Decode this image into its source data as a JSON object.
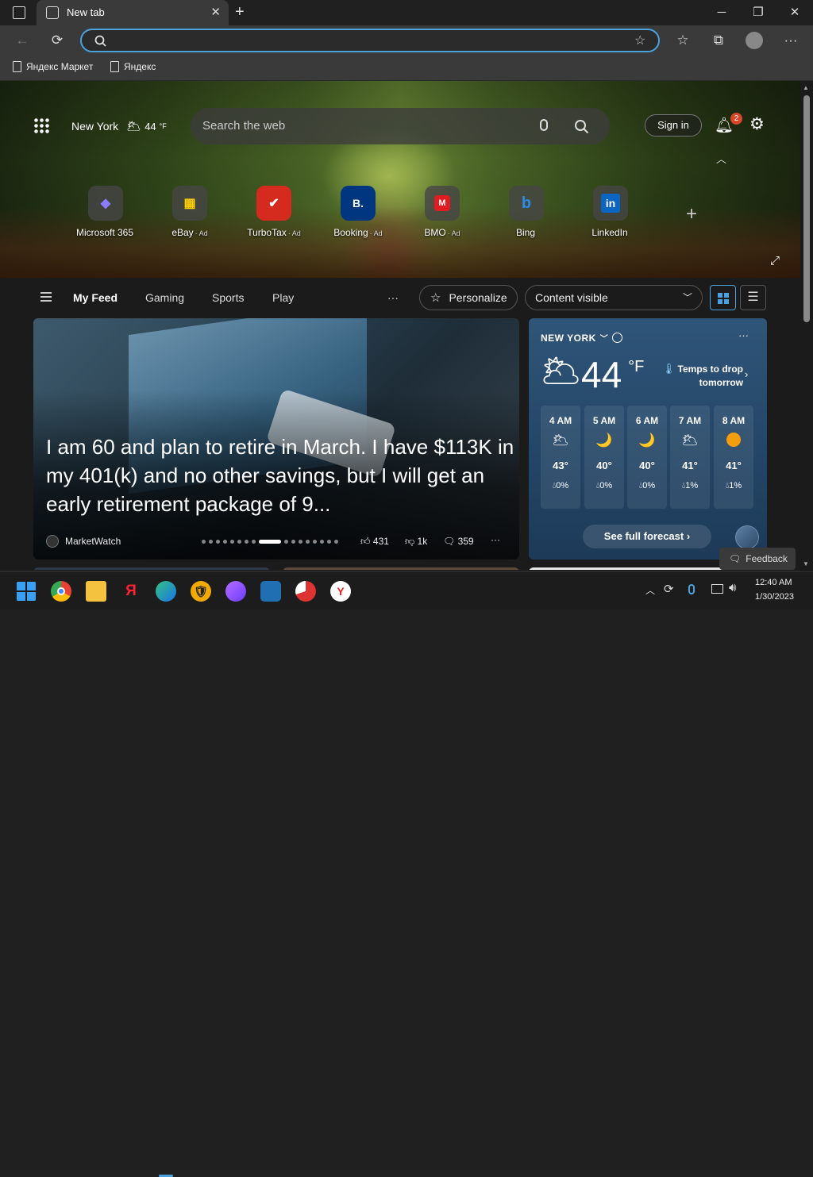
{
  "browser": {
    "tab_title": "New tab",
    "bookmarks": [
      "Яндекс Маркет",
      "Яндекс"
    ],
    "window_controls": {
      "minimize": "─",
      "restore": "❐",
      "close": "✕"
    }
  },
  "header": {
    "location": "New York",
    "temp": "44",
    "unit": "°F",
    "search_placeholder": "Search the web",
    "sign_in": "Sign in",
    "notification_count": "2"
  },
  "shortcuts": [
    {
      "label": "Microsoft 365",
      "ad": "",
      "color": "#6b4fd8",
      "glyph": "◆"
    },
    {
      "label": "eBay",
      "ad": "· Ad",
      "color": "#3a3a3a",
      "glyph": "▦"
    },
    {
      "label": "TurboTax",
      "ad": "· Ad",
      "color": "#d52b1e",
      "glyph": "✔"
    },
    {
      "label": "Booking",
      "ad": "· Ad",
      "color": "#003580",
      "glyph": "B."
    },
    {
      "label": "BMO",
      "ad": "· Ad",
      "color": "#e01b22",
      "glyph": "M"
    },
    {
      "label": "Bing",
      "ad": "",
      "color": "#2b2b2b",
      "glyph": "b"
    },
    {
      "label": "LinkedIn",
      "ad": "",
      "color": "#0a66c2",
      "glyph": "in"
    }
  ],
  "feed_nav": {
    "items": [
      "My Feed",
      "Gaming",
      "Sports",
      "Play"
    ],
    "more": "···",
    "personalize": "Personalize",
    "content_select": "Content visible"
  },
  "story": {
    "title": "I am 60 and plan to retire in March. I have $113K in my 401(k) and no other savings, but I will get an early retirement package of 9...",
    "source": "MarketWatch",
    "likes": "431",
    "dislikes": "1k",
    "comments": "359",
    "more": "···"
  },
  "weather": {
    "location": "NEW YORK",
    "temp": "44",
    "unit": "°F",
    "alert": "Temps to drop tomorrow",
    "forecast_button": "See full forecast",
    "hours": [
      {
        "time": "4 AM",
        "icon": "🌥",
        "temp": "43°",
        "precip": "0%"
      },
      {
        "time": "5 AM",
        "icon": "🌙",
        "temp": "40°",
        "precip": "0%"
      },
      {
        "time": "6 AM",
        "icon": "🌙",
        "temp": "40°",
        "precip": "0%"
      },
      {
        "time": "7 AM",
        "icon": "🌥",
        "temp": "41°",
        "precip": "1%"
      },
      {
        "time": "8 AM",
        "icon": "🟠",
        "temp": "41°",
        "precip": "1%"
      }
    ]
  },
  "feedback": "Feedback",
  "taskbar": {
    "time": "12:40 AM",
    "date": "1/30/2023"
  }
}
